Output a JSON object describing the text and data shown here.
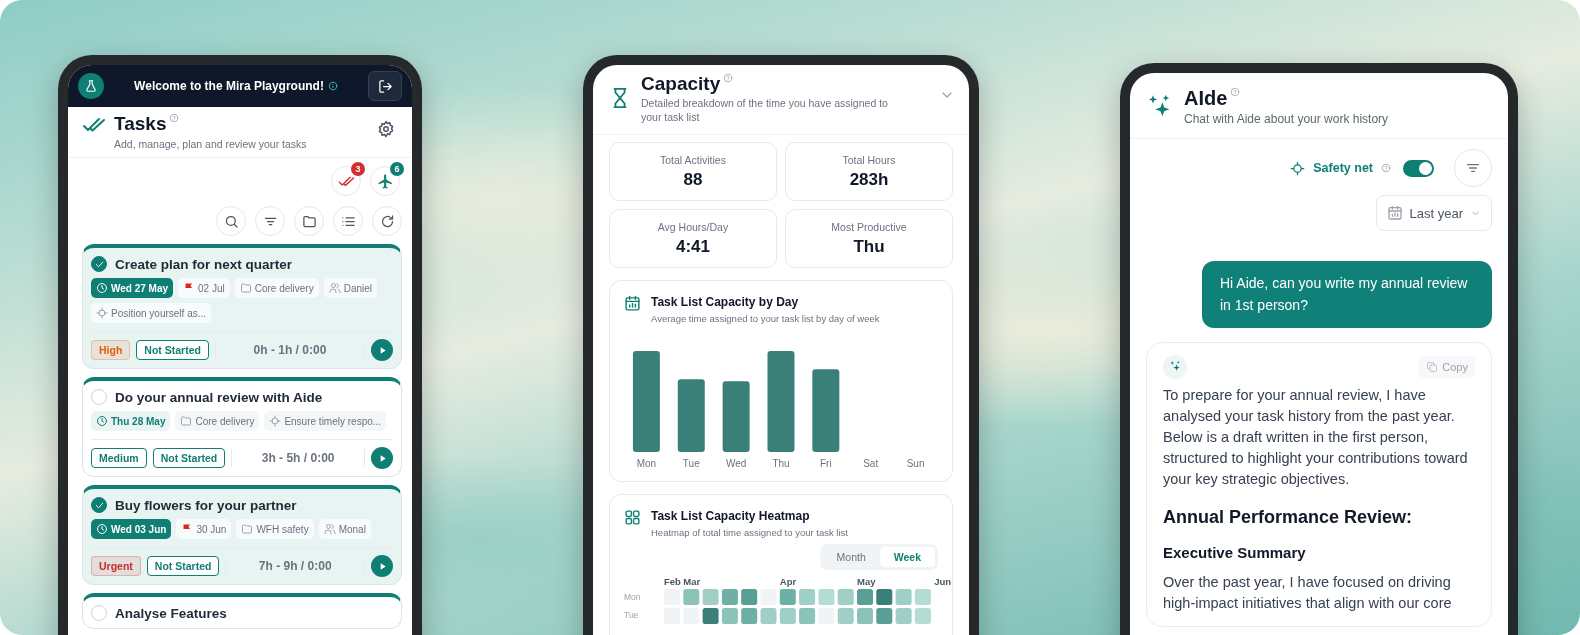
{
  "tasks_screen": {
    "banner": "Welcome to the Mira Playground!",
    "title": "Tasks",
    "subtitle": "Add, manage, plan and review your tasks",
    "badges": [
      {
        "kind": "checks",
        "count": "3",
        "color": "#d32f2f"
      },
      {
        "kind": "plane",
        "count": "6",
        "color": "#0f7f74"
      }
    ],
    "tasks": [
      {
        "title": "Create plan for next quarter",
        "done": true,
        "tags": [
          {
            "kind": "date",
            "text": "Wed 27 May"
          },
          {
            "kind": "deadline",
            "text": "02 Jul"
          },
          {
            "kind": "project",
            "text": "Core delivery"
          },
          {
            "kind": "people",
            "text": "Daniel"
          },
          {
            "kind": "goal",
            "text": "Position yourself as..."
          }
        ],
        "priority": {
          "label": "High",
          "kind": "soft",
          "color": "#e8590c"
        },
        "status": "Not Started",
        "time": "0h - 1h / 0:00"
      },
      {
        "title": "Do your annual review with Aide",
        "done": false,
        "tags": [
          {
            "kind": "date",
            "text": "Thu 28 May"
          },
          {
            "kind": "project",
            "text": "Core delivery"
          },
          {
            "kind": "goal",
            "text": "Ensure timely respo..."
          }
        ],
        "priority": {
          "label": "Medium",
          "kind": "outline",
          "color": "#0f7f74"
        },
        "status": "Not Started",
        "time": "3h - 5h / 0:00"
      },
      {
        "title": "Buy flowers for your partner",
        "done": true,
        "tags": [
          {
            "kind": "date",
            "text": "Wed 03 Jun"
          },
          {
            "kind": "deadline",
            "text": "30 Jun"
          },
          {
            "kind": "project",
            "text": "WFH safety"
          },
          {
            "kind": "people",
            "text": "Monal"
          }
        ],
        "priority": {
          "label": "Urgent",
          "kind": "soft",
          "color": "#c92a2a"
        },
        "status": "Not Started",
        "time": "7h - 9h / 0:00"
      },
      {
        "title": "Analyse Features",
        "done": false
      }
    ]
  },
  "capacity": {
    "title": "Capacity",
    "subtitle": "Detailed breakdown of the time you have assigned to your task list",
    "stats": [
      {
        "label": "Total Activities",
        "value": "88"
      },
      {
        "label": "Total Hours",
        "value": "283h"
      },
      {
        "label": "Avg Hours/Day",
        "value": "4:41"
      },
      {
        "label": "Most Productive",
        "value": "Thu"
      }
    ],
    "by_day": {
      "title": "Task List Capacity by Day",
      "subtitle": "Average time assigned to your task list by day of week",
      "days": [
        "Mon",
        "Tue",
        "Wed",
        "Thu",
        "Fri",
        "Sat",
        "Sun"
      ]
    },
    "heatmap": {
      "title": "Task List Capacity Heatmap",
      "subtitle": "Heatmap of total time assigned to your task list",
      "tabs": [
        {
          "label": "Month",
          "selected": false
        },
        {
          "label": "Week",
          "selected": true
        }
      ],
      "months": [
        "Feb",
        "Mar",
        "Apr",
        "May",
        "Jun"
      ],
      "weekdays": [
        "Mon",
        "Tue"
      ]
    }
  },
  "aide": {
    "title": "AIde",
    "subtitle": "Chat with Aide about your work history",
    "safety_net": {
      "label": "Safety net",
      "on": true
    },
    "range": "Last year",
    "user_message": "Hi Aide, can you write my annual review in 1st person?",
    "reply": {
      "copy": "Copy",
      "intro": "To prepare for your annual review, I have analysed your task history from the past year. Below is a draft written in the first person, structured to highlight your contributions toward your key strategic objectives.",
      "heading": "Annual Performance Review:",
      "subheading": "Executive Summary",
      "body": "Over the past year, I have focused on driving high-impact initiatives that align with our core"
    }
  }
}
